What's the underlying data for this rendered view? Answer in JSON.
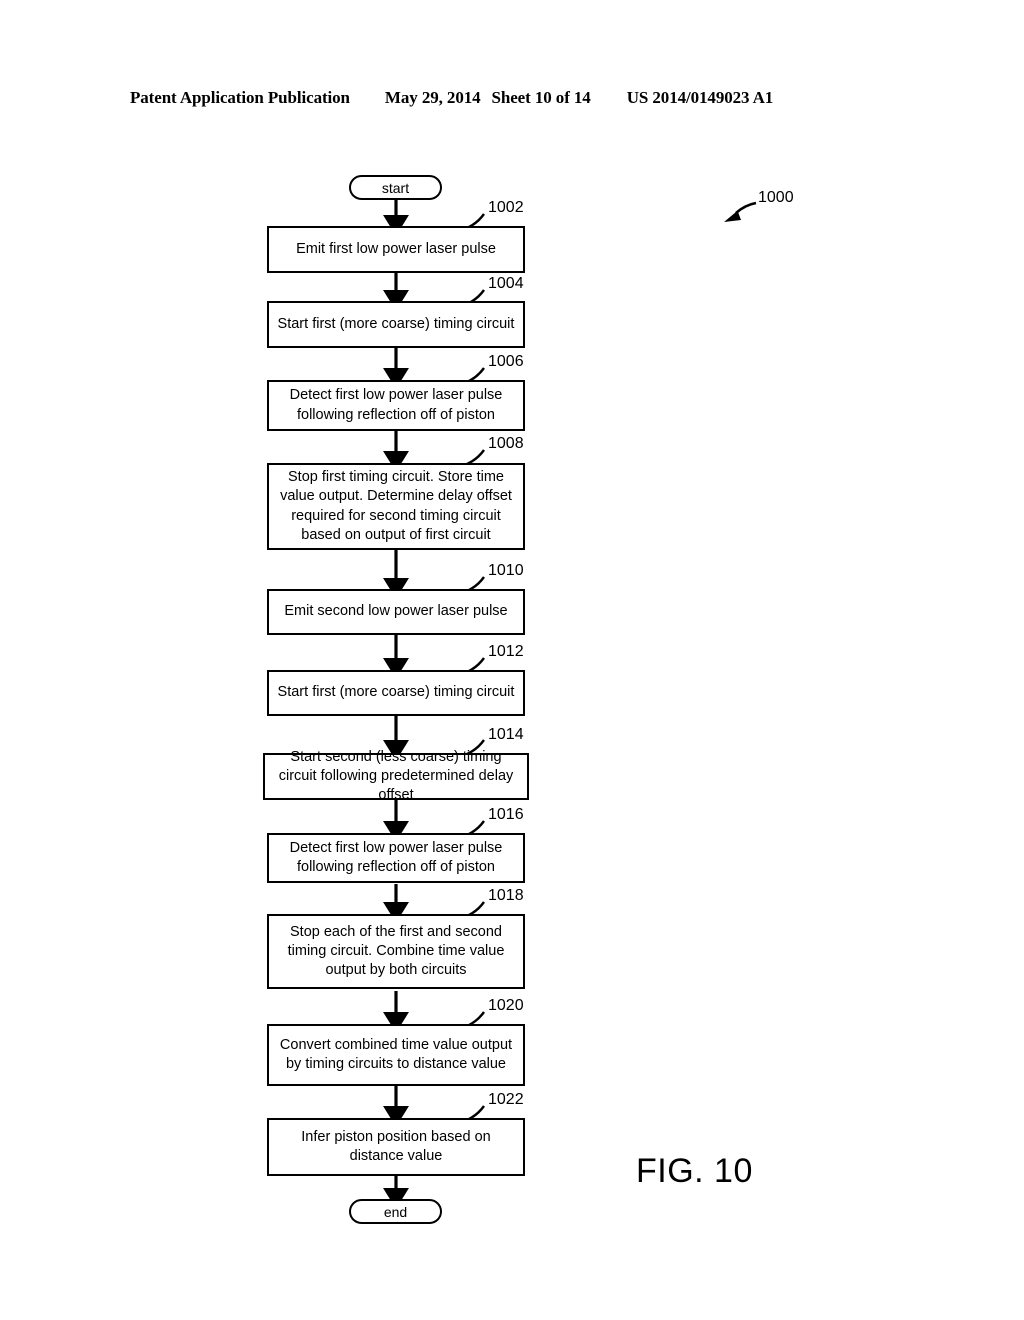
{
  "header": {
    "publication": "Patent Application Publication",
    "date": "May 29, 2014",
    "sheet": "Sheet 10 of 14",
    "patent_number": "US 2014/0149023 A1"
  },
  "figure": {
    "caption": "FIG. 10",
    "diagram_ref": "1000"
  },
  "flowchart": {
    "start_label": "start",
    "end_label": "end",
    "steps": [
      {
        "ref": "1002",
        "text": "Emit first low power laser pulse"
      },
      {
        "ref": "1004",
        "text": "Start first (more coarse) timing circuit"
      },
      {
        "ref": "1006",
        "text": "Detect first low power laser pulse following reflection off of piston"
      },
      {
        "ref": "1008",
        "text": "Stop first timing circuit.  Store  time value output. Determine delay offset required for second timing circuit based on output of first circuit"
      },
      {
        "ref": "1010",
        "text": "Emit second low power laser pulse"
      },
      {
        "ref": "1012",
        "text": "Start first (more coarse) timing circuit"
      },
      {
        "ref": "1014",
        "text": "Start second (less coarse) timing circuit following predetermined delay offset"
      },
      {
        "ref": "1016",
        "text": "Detect first low power laser pulse following reflection off of piston"
      },
      {
        "ref": "1018",
        "text": "Stop each of the first and second timing circuit.  Combine time value output by both circuits"
      },
      {
        "ref": "1020",
        "text": "Convert combined time value output by timing circuits to distance value"
      },
      {
        "ref": "1022",
        "text": "Infer piston position based on distance value"
      }
    ]
  }
}
